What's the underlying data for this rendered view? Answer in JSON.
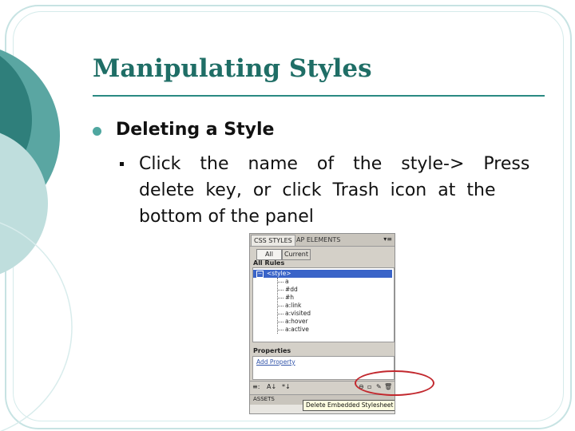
{
  "slide": {
    "title": "Manipulating Styles",
    "bullet_heading": "Deleting a Style",
    "body_lines": [
      [
        "Click",
        "the",
        "name",
        "of",
        "the",
        "style->",
        "Press"
      ],
      [
        "delete",
        "key,",
        "or",
        "click",
        "Trash",
        "icon",
        "at",
        "the"
      ],
      [
        "bottom of the panel"
      ]
    ]
  },
  "panel": {
    "tabs": [
      "CSS STYLES",
      "AP ELEMENTS"
    ],
    "menu_icon": "menu-icon",
    "buttons": {
      "all": "All",
      "current": "Current"
    },
    "all_rules_label": "All Rules",
    "tree": {
      "selected": "<style>",
      "children": [
        "a",
        "#dd",
        "#h",
        "a:link",
        "a:visited",
        "a:hover",
        "a:active"
      ]
    },
    "properties_label": "Properties",
    "add_property": "Add Property",
    "toolbar_icons": [
      "show-category-view-icon",
      "show-alphabetical-view-icon",
      "show-set-properties-icon",
      "attach-style-sheet-icon",
      "new-css-rule-icon",
      "edit-style-icon",
      "trash-icon"
    ],
    "bottom_tabs": [
      "ASSETS"
    ],
    "tooltip": "Delete Embedded Stylesheet"
  },
  "colors": {
    "title": "#1f6e66",
    "bullet": "#4fa7a0",
    "highlight": "#c2282e",
    "selection": "#3a64c8"
  }
}
